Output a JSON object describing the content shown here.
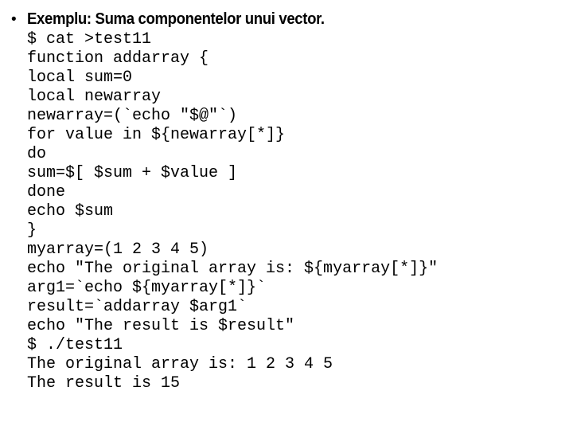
{
  "slide": {
    "background_color": "#ffffff",
    "text_color": "#000000",
    "bullet": {
      "marker": "•",
      "title": "Exemplu: Suma componentelor unui vector."
    },
    "code_lines": [
      "$ cat >test11",
      "function addarray {",
      "local sum=0",
      "local newarray",
      "newarray=(`echo \"$@\"`)",
      "for value in ${newarray[*]}",
      "do",
      "sum=$[ $sum + $value ]",
      "done",
      "echo $sum",
      "}",
      "myarray=(1 2 3 4 5)",
      "echo \"The original array is: ${myarray[*]}\"",
      "arg1=`echo ${myarray[*]}`",
      "result=`addarray $arg1`",
      "echo \"The result is $result\"",
      "$ ./test11",
      "The original array is: 1 2 3 4 5",
      "The result is 15"
    ]
  }
}
